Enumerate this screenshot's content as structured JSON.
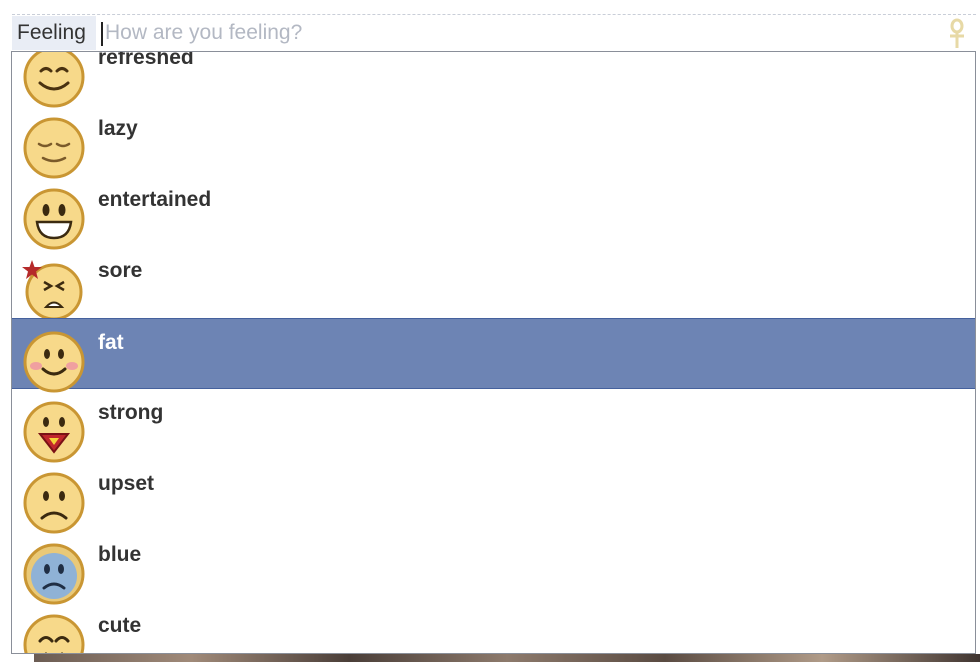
{
  "input": {
    "tag": "Feeling",
    "placeholder": "How are you feeling?",
    "value": ""
  },
  "list_items": [
    {
      "label": "refreshed",
      "icon": "smile-content-icon",
      "selected": false
    },
    {
      "label": "lazy",
      "icon": "relaxed-sleepy-icon",
      "selected": false
    },
    {
      "label": "entertained",
      "icon": "grin-icon",
      "selected": false
    },
    {
      "label": "sore",
      "icon": "sore-star-icon",
      "selected": false
    },
    {
      "label": "fat",
      "icon": "blush-chubby-icon",
      "selected": true
    },
    {
      "label": "strong",
      "icon": "superman-icon",
      "selected": false
    },
    {
      "label": "upset",
      "icon": "frown-icon",
      "selected": false
    },
    {
      "label": "blue",
      "icon": "sad-blue-icon",
      "selected": false
    },
    {
      "label": "cute",
      "icon": "cute-icon",
      "selected": false
    }
  ],
  "colors": {
    "selected_bg": "#6d84b4",
    "emoji_face": "#f7d98a",
    "emoji_outline": "#c99633"
  }
}
